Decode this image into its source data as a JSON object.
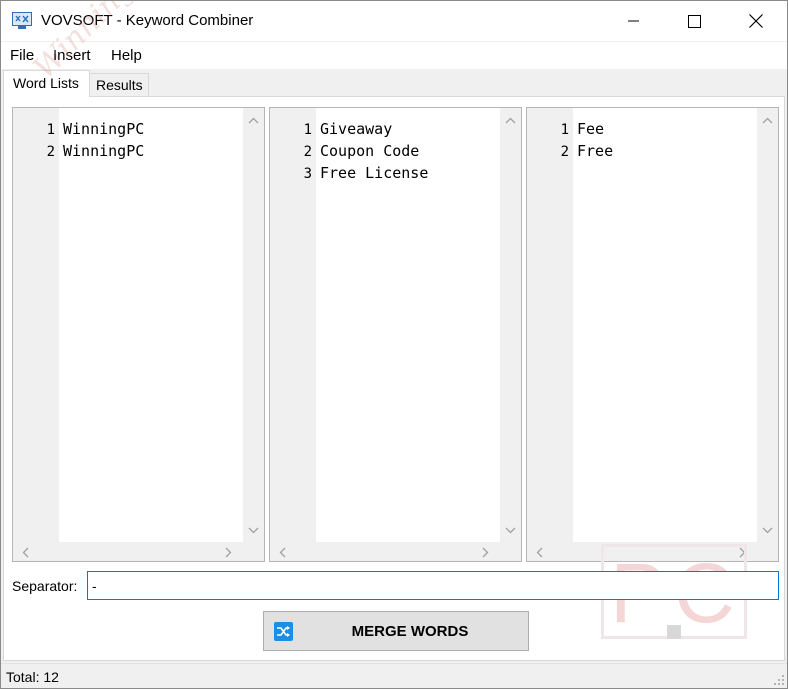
{
  "window": {
    "title": "VOVSOFT - Keyword Combiner"
  },
  "menu": {
    "file": "File",
    "insert": "Insert",
    "help": "Help"
  },
  "tabs": {
    "word_lists": "Word Lists",
    "results": "Results"
  },
  "editors": [
    {
      "lines": [
        "WinningPC",
        "WinningPC"
      ]
    },
    {
      "lines": [
        "Giveaway",
        "Coupon Code",
        "Free License"
      ]
    },
    {
      "lines": [
        "Fee",
        "Free"
      ]
    }
  ],
  "line_numbers": [
    "1",
    "2",
    "3"
  ],
  "separator": {
    "label": "Separator:",
    "value": "-"
  },
  "merge_button": {
    "label": "MERGE WORDS"
  },
  "status": {
    "text": "Total: 12"
  },
  "watermark": {
    "logo_text": "PC",
    "script_text": "WinningPC"
  },
  "colors": {
    "accent": "#0078d7",
    "merge_icon": "#1c8ee6",
    "watermark": "#f4d6d6"
  }
}
